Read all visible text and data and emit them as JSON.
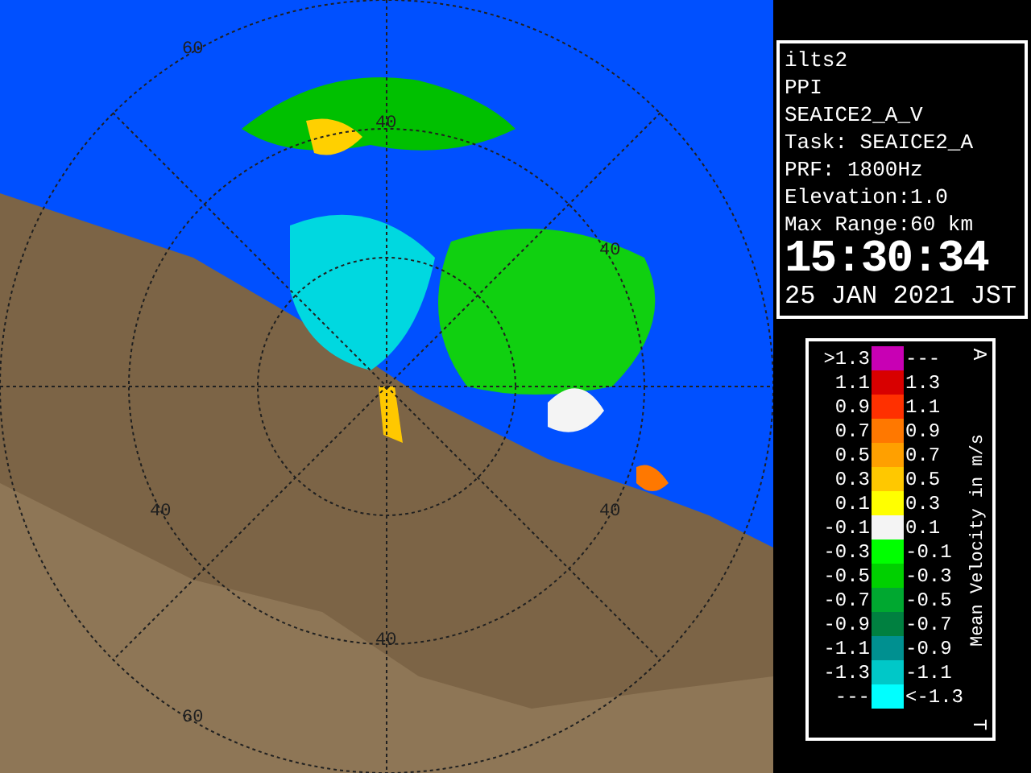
{
  "radar_map": {
    "range_labels": [
      "60",
      "40",
      "40",
      "40",
      "40",
      "60",
      "40"
    ]
  },
  "info_panel": {
    "lines": [
      "ilts2",
      "PPI",
      "SEAICE2_A_V",
      "Task: SEAICE2_A",
      "PRF: 1800Hz",
      "Elevation:1.0",
      "Max Range:60 km"
    ],
    "time": "15:30:34",
    "date": "25 JAN 2021 JST"
  },
  "legend": {
    "top_mark": "A",
    "title": "Mean Velocity in m/s",
    "bottom_mark": "T",
    "rows": [
      {
        "upper": ">1.3",
        "lower": "---",
        "color": "#c800b4"
      },
      {
        "upper": "1.1",
        "lower": "1.3",
        "color": "#d80000"
      },
      {
        "upper": "0.9",
        "lower": "1.1",
        "color": "#ff3000"
      },
      {
        "upper": "0.7",
        "lower": "0.9",
        "color": "#ff7800"
      },
      {
        "upper": "0.5",
        "lower": "0.7",
        "color": "#ffa000"
      },
      {
        "upper": "0.3",
        "lower": "0.5",
        "color": "#ffc800"
      },
      {
        "upper": "0.1",
        "lower": "0.3",
        "color": "#ffff00"
      },
      {
        "upper": "-0.1",
        "lower": "0.1",
        "color": "#f4f4f4"
      },
      {
        "upper": "-0.3",
        "lower": "-0.1",
        "color": "#00ff00"
      },
      {
        "upper": "-0.5",
        "lower": "-0.3",
        "color": "#00d000"
      },
      {
        "upper": "-0.7",
        "lower": "-0.5",
        "color": "#00a830"
      },
      {
        "upper": "-0.9",
        "lower": "-0.7",
        "color": "#008040"
      },
      {
        "upper": "-1.1",
        "lower": "-0.9",
        "color": "#009090"
      },
      {
        "upper": "-1.3",
        "lower": "-1.1",
        "color": "#00c8c8"
      },
      {
        "upper": "---",
        "lower": "<-1.3",
        "color": "#00ffff"
      }
    ]
  }
}
